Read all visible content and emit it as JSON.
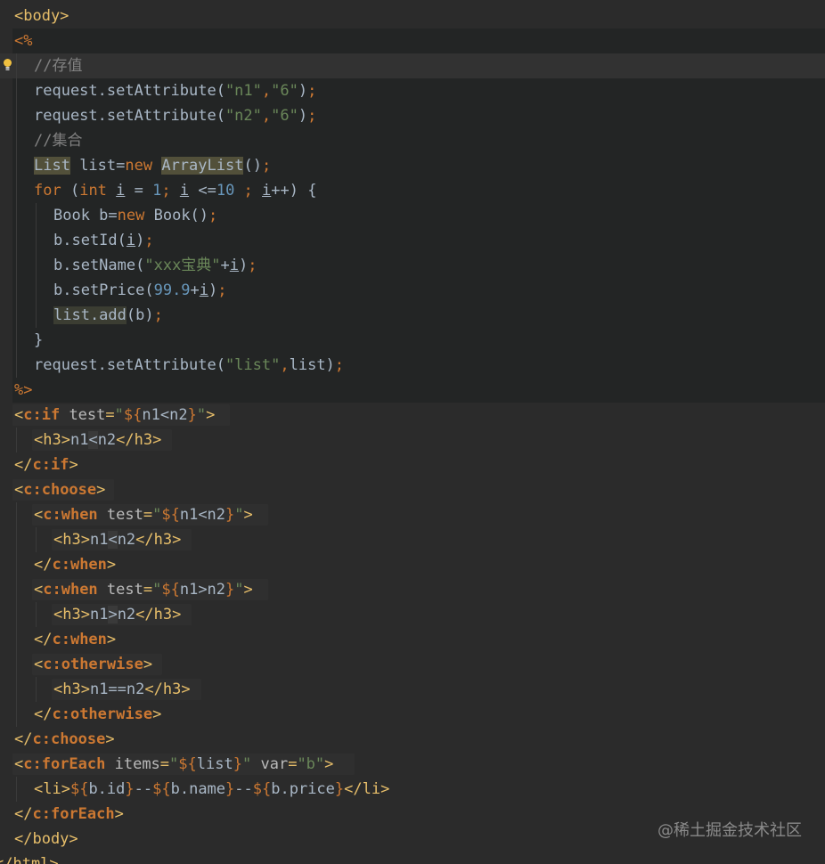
{
  "editor": {
    "language": "JSP",
    "colors": {
      "background": "#2b2b2b",
      "java_block_background": "#232525",
      "tag": "#e8bf6a",
      "keyword": "#cc7832",
      "string": "#6a8759",
      "number": "#6897bb",
      "comment": "#808080",
      "plain": "#a9b7c6"
    },
    "gutter_icon": "lightbulb-icon",
    "lines": [
      [
        [
          "t-tag",
          "<body>"
        ]
      ],
      [
        [
          "t-el",
          "<%"
        ]
      ],
      [
        [
          "t-cm",
          "//存值"
        ]
      ],
      [
        [
          "t-pl",
          "request.setAttribute("
        ],
        [
          "t-str",
          "\"n1\""
        ],
        [
          "t-el",
          ","
        ],
        [
          "t-str",
          "\"6\""
        ],
        [
          "t-pl",
          ")"
        ],
        [
          "t-el",
          ";"
        ]
      ],
      [
        [
          "t-pl",
          "request.setAttribute("
        ],
        [
          "t-str",
          "\"n2\""
        ],
        [
          "t-el",
          ","
        ],
        [
          "t-str",
          "\"6\""
        ],
        [
          "t-pl",
          ")"
        ],
        [
          "t-el",
          ";"
        ]
      ],
      [
        [
          "t-cm",
          "//集合"
        ]
      ],
      [
        [
          "t-class-hl",
          "List"
        ],
        [
          "t-pl",
          " list="
        ],
        [
          "t-kw",
          "new "
        ],
        [
          "t-class-hl",
          "ArrayList"
        ],
        [
          "t-pl",
          "()"
        ],
        [
          "t-el",
          ";"
        ]
      ],
      [
        [
          "t-kw",
          "for "
        ],
        [
          "t-pl",
          "("
        ],
        [
          "t-kw",
          "int "
        ],
        [
          "t-var",
          "i"
        ],
        [
          "t-pl",
          " = "
        ],
        [
          "t-num",
          "1"
        ],
        [
          "t-el",
          "; "
        ],
        [
          "t-var",
          "i"
        ],
        [
          "t-pl",
          " <="
        ],
        [
          "t-num",
          "10"
        ],
        [
          "t-el",
          " ; "
        ],
        [
          "t-var",
          "i"
        ],
        [
          "t-pl",
          "++) {"
        ]
      ],
      [
        [
          "t-pl",
          "Book b="
        ],
        [
          "t-kw",
          "new "
        ],
        [
          "t-pl",
          "Book()"
        ],
        [
          "t-el",
          ";"
        ]
      ],
      [
        [
          "t-pl",
          "b.setId("
        ],
        [
          "t-var",
          "i"
        ],
        [
          "t-pl",
          ")"
        ],
        [
          "t-el",
          ";"
        ]
      ],
      [
        [
          "t-pl",
          "b.setName("
        ],
        [
          "t-str",
          "\"xxx宝典\""
        ],
        [
          "t-pl",
          "+"
        ],
        [
          "t-var",
          "i"
        ],
        [
          "t-pl",
          ")"
        ],
        [
          "t-el",
          ";"
        ]
      ],
      [
        [
          "t-pl",
          "b.setPrice("
        ],
        [
          "t-num",
          "99.9"
        ],
        [
          "t-pl",
          "+"
        ],
        [
          "t-var",
          "i"
        ],
        [
          "t-pl",
          ")"
        ],
        [
          "t-el",
          ";"
        ]
      ],
      [
        [
          "t-add-hl",
          "list.add"
        ],
        [
          "t-pl",
          "(b)"
        ],
        [
          "t-el",
          ";"
        ]
      ],
      [
        [
          "t-pl",
          "}"
        ]
      ],
      [
        [
          "t-pl",
          "request.setAttribute("
        ],
        [
          "t-str",
          "\"list\""
        ],
        [
          "t-el",
          ","
        ],
        [
          "t-pl",
          "list)"
        ],
        [
          "t-el",
          ";"
        ]
      ],
      [
        [
          "t-el",
          "%>"
        ]
      ],
      [
        [
          "t-tag",
          "<"
        ],
        [
          "t-ns",
          "c:if"
        ],
        [
          "t-attr",
          " test"
        ],
        [
          "t-tag",
          "="
        ],
        [
          "t-str",
          "\""
        ],
        [
          "t-el",
          "${"
        ],
        [
          "t-pl",
          "n1<n2"
        ],
        [
          "t-el",
          "}"
        ],
        [
          "t-str",
          "\""
        ],
        [
          "t-tag",
          ">"
        ]
      ],
      [
        [
          "t-tag",
          "<h3>"
        ],
        [
          "t-pl",
          "n1"
        ],
        [
          "t-dim",
          "<"
        ],
        [
          "t-pl",
          "n2"
        ],
        [
          "t-tag",
          "</h3>"
        ]
      ],
      [
        [
          "t-tag",
          "</"
        ],
        [
          "t-ns",
          "c:if"
        ],
        [
          "t-tag",
          ">"
        ]
      ],
      [
        [
          "t-tag",
          "<"
        ],
        [
          "t-ns",
          "c:choose"
        ],
        [
          "t-tag",
          ">"
        ]
      ],
      [
        [
          "t-tag",
          "<"
        ],
        [
          "t-ns",
          "c:when"
        ],
        [
          "t-attr",
          " test"
        ],
        [
          "t-tag",
          "="
        ],
        [
          "t-str",
          "\""
        ],
        [
          "t-el",
          "${"
        ],
        [
          "t-pl",
          "n1<n2"
        ],
        [
          "t-el",
          "}"
        ],
        [
          "t-str",
          "\""
        ],
        [
          "t-tag",
          ">"
        ]
      ],
      [
        [
          "t-tag",
          "<h3>"
        ],
        [
          "t-pl",
          "n1"
        ],
        [
          "t-dim",
          "<"
        ],
        [
          "t-pl",
          "n2"
        ],
        [
          "t-tag",
          "</h3>"
        ]
      ],
      [
        [
          "t-tag",
          "</"
        ],
        [
          "t-ns",
          "c:when"
        ],
        [
          "t-tag",
          ">"
        ]
      ],
      [
        [
          "t-tag",
          "<"
        ],
        [
          "t-ns",
          "c:when"
        ],
        [
          "t-attr",
          " test"
        ],
        [
          "t-tag",
          "="
        ],
        [
          "t-str",
          "\""
        ],
        [
          "t-el",
          "${"
        ],
        [
          "t-pl",
          "n1>n2"
        ],
        [
          "t-el",
          "}"
        ],
        [
          "t-str",
          "\""
        ],
        [
          "t-tag",
          ">"
        ]
      ],
      [
        [
          "t-tag",
          "<h3>"
        ],
        [
          "t-pl",
          "n1"
        ],
        [
          "t-dim",
          ">"
        ],
        [
          "t-pl",
          "n2"
        ],
        [
          "t-tag",
          "</h3>"
        ]
      ],
      [
        [
          "t-tag",
          "</"
        ],
        [
          "t-ns",
          "c:when"
        ],
        [
          "t-tag",
          ">"
        ]
      ],
      [
        [
          "t-tag",
          "<"
        ],
        [
          "t-ns",
          "c:otherwise"
        ],
        [
          "t-tag",
          ">"
        ]
      ],
      [
        [
          "t-tag",
          "<h3>"
        ],
        [
          "t-pl",
          "n1==n2"
        ],
        [
          "t-tag",
          "</h3>"
        ]
      ],
      [
        [
          "t-tag",
          "</"
        ],
        [
          "t-ns",
          "c:otherwise"
        ],
        [
          "t-tag",
          ">"
        ]
      ],
      [
        [
          "t-tag",
          "</"
        ],
        [
          "t-ns",
          "c:choose"
        ],
        [
          "t-tag",
          ">"
        ]
      ],
      [
        [
          "t-tag",
          "<"
        ],
        [
          "t-ns",
          "c:forEach"
        ],
        [
          "t-attr",
          " items"
        ],
        [
          "t-tag",
          "="
        ],
        [
          "t-str",
          "\""
        ],
        [
          "t-el",
          "${"
        ],
        [
          "t-pl",
          "list"
        ],
        [
          "t-el",
          "}"
        ],
        [
          "t-str",
          "\""
        ],
        [
          "t-attr",
          " var"
        ],
        [
          "t-tag",
          "="
        ],
        [
          "t-str",
          "\"b\""
        ],
        [
          "t-tag",
          ">"
        ]
      ],
      [
        [
          "t-tag",
          "<li>"
        ],
        [
          "t-el",
          "${"
        ],
        [
          "t-pl",
          "b.id"
        ],
        [
          "t-el",
          "}"
        ],
        [
          "t-pl",
          "--"
        ],
        [
          "t-el",
          "${"
        ],
        [
          "t-pl",
          "b.name"
        ],
        [
          "t-el",
          "}"
        ],
        [
          "t-pl",
          "--"
        ],
        [
          "t-el",
          "${"
        ],
        [
          "t-pl",
          "b.price"
        ],
        [
          "t-el",
          "}"
        ],
        [
          "t-tag",
          "</li>"
        ]
      ],
      [
        [
          "t-tag",
          "</"
        ],
        [
          "t-ns",
          "c:forEach"
        ],
        [
          "t-tag",
          ">"
        ]
      ],
      [
        [
          "t-tag",
          "</body>"
        ]
      ],
      [
        [
          "t-tag",
          "</html>"
        ]
      ]
    ]
  },
  "watermark": "@稀土掘金技术社区"
}
